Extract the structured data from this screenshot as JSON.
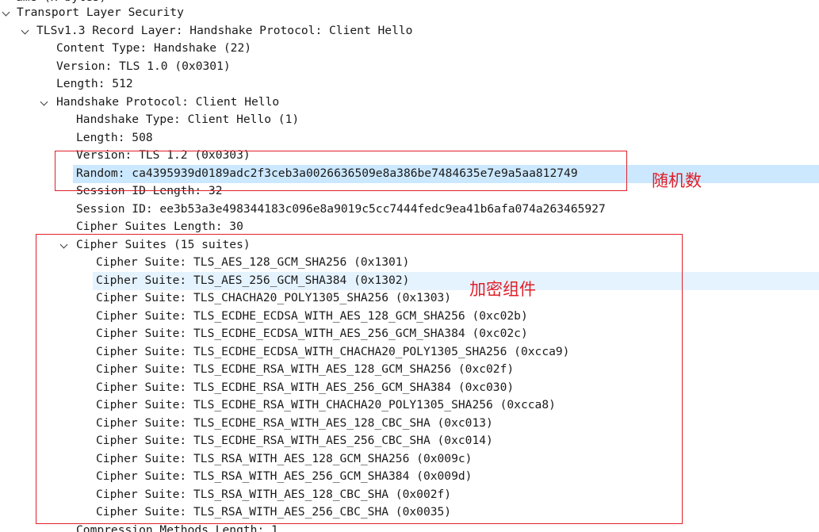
{
  "tree": {
    "partial_top": "ame (x bytes)",
    "partial_bottom": "Compression Methods Length: 1",
    "rows": [
      {
        "text": "Transport Layer Security",
        "expanded": true
      },
      {
        "text": "TLSv1.3 Record Layer: Handshake Protocol: Client Hello",
        "expanded": true
      },
      {
        "text": "Content Type: Handshake (22)"
      },
      {
        "text": "Version: TLS 1.0 (0x0301)"
      },
      {
        "text": "Length: 512"
      },
      {
        "text": "Handshake Protocol: Client Hello",
        "expanded": true
      },
      {
        "text": "Handshake Type: Client Hello (1)"
      },
      {
        "text": "Length: 508"
      },
      {
        "text": "Version: TLS 1.2 (0x0303)"
      },
      {
        "text": "Random: ca4395939d0189adc2f3ceb3a0026636509e8a386be7484635e7e9a5aa812749",
        "selected": true
      },
      {
        "text": "Session ID Length: 32"
      },
      {
        "text": "Session ID: ee3b53a3e498344183c096e8a9019c5cc7444fedc9ea41b6afa074a263465927"
      },
      {
        "text": "Cipher Suites Length: 30"
      },
      {
        "text": "Cipher Suites (15 suites)",
        "expanded": true
      },
      {
        "text": "Cipher Suite: TLS_AES_128_GCM_SHA256 (0x1301)"
      },
      {
        "text": "Cipher Suite: TLS_AES_256_GCM_SHA384 (0x1302)",
        "hover": true
      },
      {
        "text": "Cipher Suite: TLS_CHACHA20_POLY1305_SHA256 (0x1303)"
      },
      {
        "text": "Cipher Suite: TLS_ECDHE_ECDSA_WITH_AES_128_GCM_SHA256 (0xc02b)"
      },
      {
        "text": "Cipher Suite: TLS_ECDHE_ECDSA_WITH_AES_256_GCM_SHA384 (0xc02c)"
      },
      {
        "text": "Cipher Suite: TLS_ECDHE_ECDSA_WITH_CHACHA20_POLY1305_SHA256 (0xcca9)"
      },
      {
        "text": "Cipher Suite: TLS_ECDHE_RSA_WITH_AES_128_GCM_SHA256 (0xc02f)"
      },
      {
        "text": "Cipher Suite: TLS_ECDHE_RSA_WITH_AES_256_GCM_SHA384 (0xc030)"
      },
      {
        "text": "Cipher Suite: TLS_ECDHE_RSA_WITH_CHACHA20_POLY1305_SHA256 (0xcca8)"
      },
      {
        "text": "Cipher Suite: TLS_ECDHE_RSA_WITH_AES_128_CBC_SHA (0xc013)"
      },
      {
        "text": "Cipher Suite: TLS_ECDHE_RSA_WITH_AES_256_CBC_SHA (0xc014)"
      },
      {
        "text": "Cipher Suite: TLS_RSA_WITH_AES_128_GCM_SHA256 (0x009c)"
      },
      {
        "text": "Cipher Suite: TLS_RSA_WITH_AES_256_GCM_SHA384 (0x009d)"
      },
      {
        "text": "Cipher Suite: TLS_RSA_WITH_AES_128_CBC_SHA (0x002f)"
      },
      {
        "text": "Cipher Suite: TLS_RSA_WITH_AES_256_CBC_SHA (0x0035)"
      }
    ]
  },
  "annotations": {
    "random_label": "随机数",
    "cipher_label": "加密组件"
  },
  "colors": {
    "selected_row": "#cce8ff",
    "hover_row": "#e5f3ff",
    "annotation": "#e0202a"
  }
}
